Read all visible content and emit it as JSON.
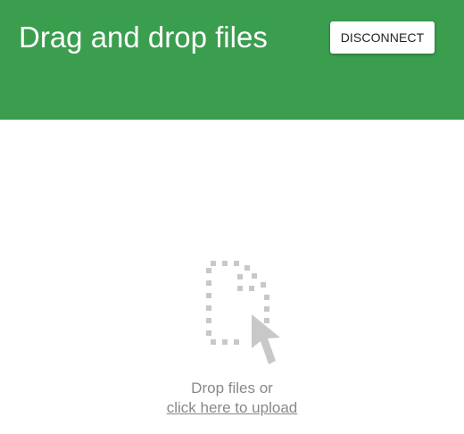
{
  "header": {
    "title": "Drag and drop files",
    "background_color": "#3a9e4e",
    "disconnect_label": "DISCONNECT"
  },
  "drop_zone": {
    "icon": "dotted-file-with-cursor-icon",
    "prompt": "Drop files or",
    "upload_link": "click here to upload",
    "text_color": "#888888"
  }
}
